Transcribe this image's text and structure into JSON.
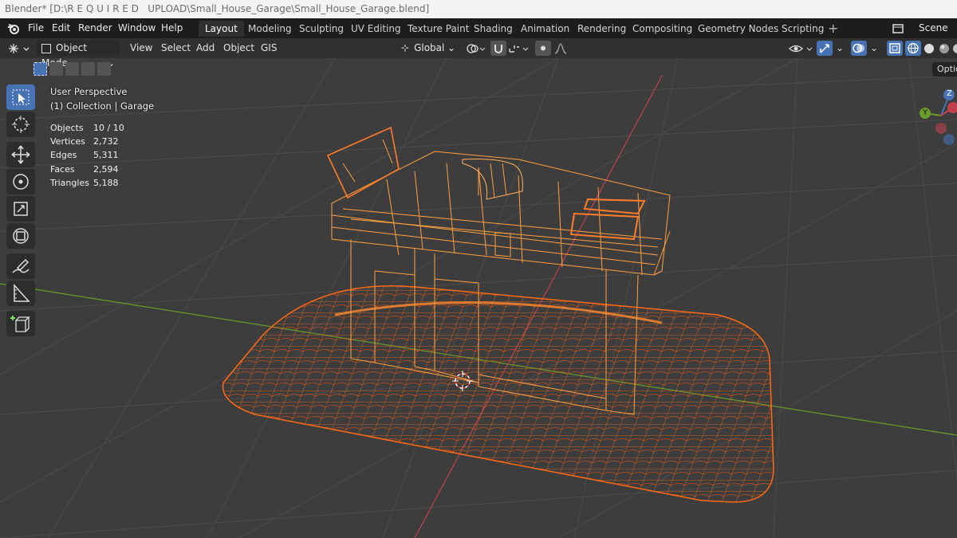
{
  "window": {
    "title": "Blender* [D:\\R E Q U I R E D   UPLOAD\\Small_House_Garage\\Small_House_Garage.blend]"
  },
  "menu": {
    "file": "File",
    "edit": "Edit",
    "render": "Render",
    "window": "Window",
    "help": "Help"
  },
  "workspaces": [
    "Layout",
    "Modeling",
    "Sculpting",
    "UV Editing",
    "Texture Paint",
    "Shading",
    "Animation",
    "Rendering",
    "Compositing",
    "Geometry Nodes",
    "Scripting"
  ],
  "scene_label": "Scene",
  "header": {
    "mode": "Object Mode",
    "view": "View",
    "select": "Select",
    "add": "Add",
    "object": "Object",
    "gis": "GIS",
    "orientation": "Global",
    "options": "Optio"
  },
  "viewport": {
    "perspective": "User Perspective",
    "collection": "(1) Collection | Garage",
    "stats": [
      {
        "label": "Objects",
        "value": "10 / 10"
      },
      {
        "label": "Vertices",
        "value": "2,732"
      },
      {
        "label": "Edges",
        "value": "5,311"
      },
      {
        "label": "Faces",
        "value": "2,594"
      },
      {
        "label": "Triangles",
        "value": "5,188"
      }
    ]
  },
  "gizmo": {
    "z": "Z",
    "y": "Y"
  },
  "colors": {
    "accent": "#4772b3",
    "wireframe": "#ff7f1a",
    "grid": "#4a4a4a",
    "x_axis": "#c0414d",
    "y_axis": "#6b9c2a"
  }
}
